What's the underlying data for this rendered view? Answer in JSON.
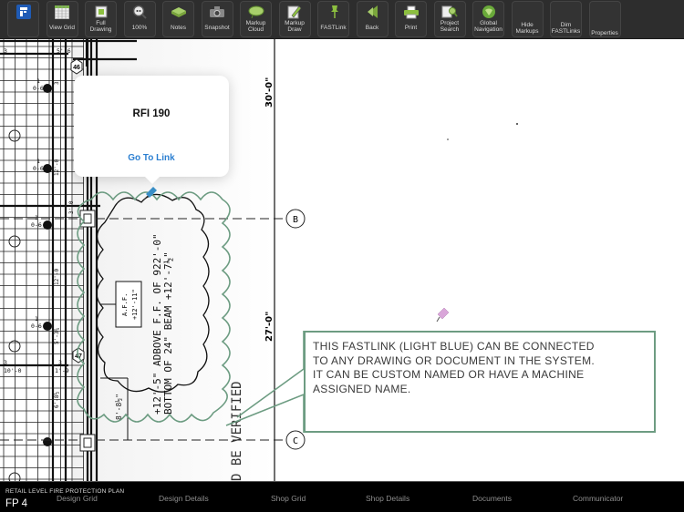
{
  "toolbar": {
    "buttons": [
      {
        "id": "app",
        "label": "",
        "icon": "app-logo-icon"
      },
      {
        "id": "view-grid",
        "label": "View Grid",
        "icon": "grid-icon"
      },
      {
        "id": "full-drawing",
        "label": "Full\nDrawing",
        "icon": "full-drawing-icon"
      },
      {
        "id": "zoom-100",
        "label": "100%",
        "icon": "magnifier-icon"
      },
      {
        "id": "notes",
        "label": "Notes",
        "icon": "notes-icon"
      },
      {
        "id": "snapshot",
        "label": "Snapshot",
        "icon": "camera-icon"
      },
      {
        "id": "markup-cloud",
        "label": "Markup\nCloud",
        "icon": "cloud-icon"
      },
      {
        "id": "markup-draw",
        "label": "Markup\nDraw",
        "icon": "pencil-icon"
      },
      {
        "id": "fastlink",
        "label": "FASTLink",
        "icon": "pushpin-icon"
      },
      {
        "id": "back",
        "label": "Back",
        "icon": "back-arrow-icon"
      },
      {
        "id": "print",
        "label": "Print",
        "icon": "printer-icon"
      },
      {
        "id": "project-search",
        "label": "Project\nSearch",
        "icon": "search-document-icon"
      },
      {
        "id": "global-navigation",
        "label": "Global\nNavigation",
        "icon": "globe-icon"
      },
      {
        "id": "hide-markups",
        "label": "Hide\nMarkups",
        "icon": ""
      },
      {
        "id": "dim-fastlinks",
        "label": "Dim\nFASTLinks",
        "icon": ""
      },
      {
        "id": "properties",
        "label": "Properties",
        "icon": ""
      }
    ]
  },
  "popover": {
    "title": "RFI 190",
    "link_label": "Go To Link"
  },
  "callout": {
    "lines": [
      "THIS FASTLINK (LIGHT BLUE) CAN BE CONNECTED",
      "TO ANY DRAWING OR DOCUMENT IN THE SYSTEM.",
      "IT CAN BE CUSTOM NAMED OR HAVE A MACHINE",
      "ASSIGNED NAME."
    ]
  },
  "drawing": {
    "dims": {
      "upper": "30'-0\"",
      "lower": "27'-0\""
    },
    "grid_bubbles": {
      "b": "B",
      "c": "C"
    },
    "tags": {
      "t46": "46",
      "t47": "47"
    },
    "note_line1": "+12'-5\" ADBOVE F.F. OF 922'-0\"",
    "note_line2": "BOTTOM OF 24\" BEAM +12'-7½\"",
    "aff_label": "A.F.F.",
    "aff_value": "+12'-11\"",
    "dim_small": "8'-8½\"",
    "verified": "D BE VERIFIED",
    "pipe_labels": [
      "1½",
      "12'-0",
      "1½",
      "5'-3¾",
      "1½",
      "6'-8½",
      "1½",
      "12'-0",
      "1½",
      "10'-0",
      "3",
      "3'-0"
    ],
    "branch_labels": [
      "1",
      "0-6"
    ],
    "row_labels": [
      "3",
      "10'-0",
      "3",
      "1'-9",
      "3",
      "5'-6"
    ]
  },
  "bottombar": {
    "sheet_title": "RETAIL LEVEL FIRE PROTECTION PLAN",
    "sheet_number": "FP  4",
    "tabs": [
      "Design Grid",
      "Design Details",
      "Shop Grid",
      "Shop Details",
      "Documents",
      "Communicator"
    ]
  },
  "colors": {
    "toolbar_bg": "#2d2d2d",
    "markup_green": "#6d9c82",
    "fastlink_blue": "#3a8fc7",
    "fastlink_pink": "#d9a6d9",
    "link_blue": "#2b7fd1"
  }
}
